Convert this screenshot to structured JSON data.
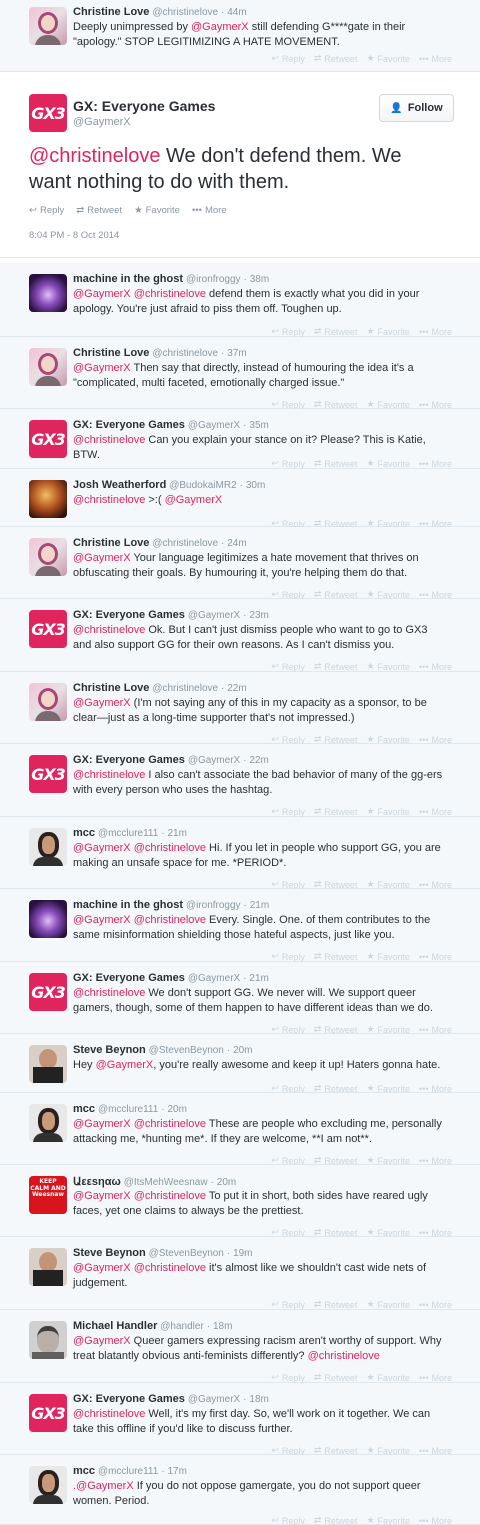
{
  "top_tweet": {
    "name": "Christine Love",
    "handle": "@christinelove",
    "time": "44m",
    "text_pre": "Deeply unimpressed by ",
    "mention": "@GaymerX",
    "text_post": " still defending G****gate in their \"apology.\" STOP LEGITIMIZING A HATE MOVEMENT."
  },
  "actions": {
    "reply": "Reply",
    "retweet": "Retweet",
    "favorite": "Favorite",
    "more": "More"
  },
  "focus_tweet": {
    "avatar_text": "GX3",
    "name": "GX: Everyone Games",
    "handle": "@GaymerX",
    "follow_label": "Follow",
    "mention": "@christinelove",
    "text": " We don't defend them. We want nothing to do with them.",
    "date": "8:04 PM - 8 Oct 2014"
  },
  "replies": [
    {
      "avatar": "mg",
      "name": "machine in the ghost",
      "handle": "@ironfroggy",
      "time": "38m",
      "parts": [
        [
          "m",
          "@GaymerX"
        ],
        [
          "t",
          " "
        ],
        [
          "m",
          "@christinelove"
        ],
        [
          "t",
          " defend them is exactly what you did in your apology. You're just afraid to piss them off. Toughen up."
        ]
      ]
    },
    {
      "avatar": "cl",
      "name": "Christine Love",
      "handle": "@christinelove",
      "time": "37m",
      "parts": [
        [
          "m",
          "@GaymerX"
        ],
        [
          "t",
          " Then say that directly, instead of humouring the idea it's a \"complicated, multi faceted, emotionally charged issue.\""
        ]
      ]
    },
    {
      "avatar": "gx",
      "name": "GX: Everyone Games",
      "handle": "@GaymerX",
      "time": "35m",
      "parts": [
        [
          "m",
          "@christinelove"
        ],
        [
          "t",
          " Can you explain your stance on it? Please? This is Katie, BTW."
        ]
      ]
    },
    {
      "avatar": "jw",
      "name": "Josh Weatherford",
      "handle": "@BudokaiMR2",
      "time": "30m",
      "parts": [
        [
          "m",
          "@christinelove"
        ],
        [
          "t",
          " >:( "
        ],
        [
          "m",
          "@GaymerX"
        ]
      ]
    },
    {
      "avatar": "cl",
      "name": "Christine Love",
      "handle": "@christinelove",
      "time": "24m",
      "parts": [
        [
          "m",
          "@GaymerX"
        ],
        [
          "t",
          " Your language legitimizes a hate movement that thrives on obfuscating their goals. By humouring it, you're helping them do that."
        ]
      ]
    },
    {
      "avatar": "gx",
      "name": "GX: Everyone Games",
      "handle": "@GaymerX",
      "time": "23m",
      "parts": [
        [
          "m",
          "@christinelove"
        ],
        [
          "t",
          " Ok. But I can't just dismiss people who want to go to GX3 and also support GG for their own reasons. As I can't dismiss you."
        ]
      ]
    },
    {
      "avatar": "cl",
      "name": "Christine Love",
      "handle": "@christinelove",
      "time": "22m",
      "parts": [
        [
          "m",
          "@GaymerX"
        ],
        [
          "t",
          " (I'm not saying any of this in my capacity as a sponsor, to be clear—just as a long-time supporter that's not impressed.)"
        ]
      ]
    },
    {
      "avatar": "gx",
      "name": "GX: Everyone Games",
      "handle": "@GaymerX",
      "time": "22m",
      "parts": [
        [
          "m",
          "@christinelove"
        ],
        [
          "t",
          " I also can't associate the bad behavior of many of the gg-ers with every person who uses the hashtag."
        ]
      ]
    },
    {
      "avatar": "mcc",
      "name": "mcc",
      "handle": "@mcclure111",
      "time": "21m",
      "parts": [
        [
          "m",
          "@GaymerX"
        ],
        [
          "t",
          " "
        ],
        [
          "m",
          "@christinelove"
        ],
        [
          "t",
          " Hi. If you let in people who support GG, you are making an unsafe space for me. *PERIOD*."
        ]
      ]
    },
    {
      "avatar": "mg",
      "name": "machine in the ghost",
      "handle": "@ironfroggy",
      "time": "21m",
      "parts": [
        [
          "m",
          "@GaymerX"
        ],
        [
          "t",
          " "
        ],
        [
          "m",
          "@christinelove"
        ],
        [
          "t",
          " Every. Single. One. of them contributes to the same misinformation shielding those hateful aspects, just like you."
        ]
      ]
    },
    {
      "avatar": "gx",
      "name": "GX: Everyone Games",
      "handle": "@GaymerX",
      "time": "21m",
      "parts": [
        [
          "m",
          "@christinelove"
        ],
        [
          "t",
          " We don't support GG. We never will. We support queer gamers, though, some of them happen to have different ideas than we do."
        ]
      ]
    },
    {
      "avatar": "sb",
      "name": "Steve Beynon",
      "handle": "@StevenBeynon",
      "time": "20m",
      "parts": [
        [
          "t",
          "Hey "
        ],
        [
          "m",
          "@GaymerX"
        ],
        [
          "t",
          ", you're really awesome and keep it up! Haters gonna hate."
        ]
      ]
    },
    {
      "avatar": "mcc",
      "name": "mcc",
      "handle": "@mcclure111",
      "time": "20m",
      "parts": [
        [
          "m",
          "@GaymerX"
        ],
        [
          "t",
          " "
        ],
        [
          "m",
          "@christinelove"
        ],
        [
          "t",
          " These are people who excluding me, personally attacking me, *hunting me*. If they are welcome, **I am not**."
        ]
      ]
    },
    {
      "avatar": "wn",
      "name": "Աεεsηαω",
      "handle": "@ItsMehWeesnaw",
      "time": "20m",
      "parts": [
        [
          "m",
          "@GaymerX"
        ],
        [
          "t",
          " "
        ],
        [
          "m",
          "@christinelove"
        ],
        [
          "t",
          " To put it in short, both sides have reared ugly faces, yet one claims to always be the prettiest."
        ]
      ]
    },
    {
      "avatar": "sb",
      "name": "Steve Beynon",
      "handle": "@StevenBeynon",
      "time": "19m",
      "parts": [
        [
          "m",
          "@GaymerX"
        ],
        [
          "t",
          " "
        ],
        [
          "m",
          "@christinelove"
        ],
        [
          "t",
          " it's almost like we shouldn't cast wide nets of judgement."
        ]
      ]
    },
    {
      "avatar": "mh",
      "name": "Michael Handler",
      "handle": "@handler",
      "time": "18m",
      "parts": [
        [
          "m",
          "@GaymerX"
        ],
        [
          "t",
          " Queer gamers expressing racism aren't worthy of support. Why treat blatantly obvious anti-feminists differently? "
        ],
        [
          "m",
          "@christinelove"
        ]
      ]
    },
    {
      "avatar": "gx",
      "name": "GX: Everyone Games",
      "handle": "@GaymerX",
      "time": "18m",
      "parts": [
        [
          "m",
          "@christinelove"
        ],
        [
          "t",
          " Well, it's my first day. So, we'll work on it together. We can take this offline if you'd like to discuss further."
        ]
      ]
    },
    {
      "avatar": "mcc",
      "name": "mcc",
      "handle": "@mcclure111",
      "time": "17m",
      "parts": [
        [
          "m",
          ".@GaymerX"
        ],
        [
          "t",
          " If you do not oppose gamergate, you do not support queer women. Period."
        ]
      ]
    }
  ],
  "weesnaw_avatar_text": "KEEP CALM AND Weesnaw",
  "colors": {
    "mention": "#e0245e",
    "accent": "#e0245e",
    "muted": "#8899a6",
    "bg": "#f5f8fa"
  }
}
